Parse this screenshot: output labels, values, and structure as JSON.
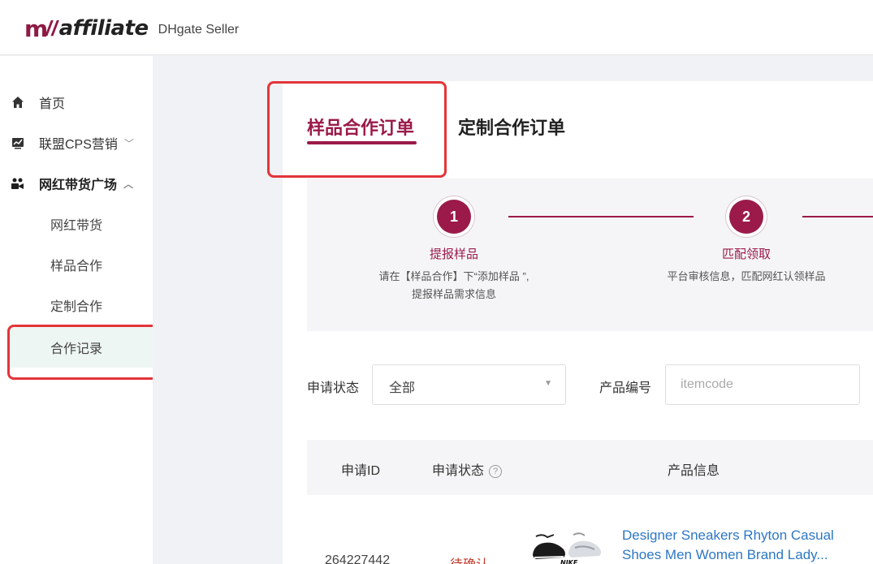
{
  "header": {
    "logo_mark": "m",
    "logo_text": "affiliate",
    "logo_sub": "DHgate Seller"
  },
  "sidebar": {
    "items": [
      {
        "label": "首页",
        "icon": "home-icon"
      },
      {
        "label": "联盟CPS营销",
        "icon": "chart-icon",
        "caret": "﹀"
      },
      {
        "label": "网红带货广场",
        "icon": "influencer-icon",
        "caret": "︿"
      }
    ],
    "subitems": [
      {
        "label": "网红带货"
      },
      {
        "label": "样品合作"
      },
      {
        "label": "定制合作"
      },
      {
        "label": "合作记录",
        "active": true
      }
    ]
  },
  "tabs": [
    {
      "label": "样品合作订单",
      "active": true
    },
    {
      "label": "定制合作订单",
      "active": false
    }
  ],
  "steps": [
    {
      "number": "1",
      "title": "提报样品",
      "desc_line1": "请在【样品合作】下“添加样品 ”,",
      "desc_line2": "提报样品需求信息"
    },
    {
      "number": "2",
      "title": "匹配领取",
      "desc_line1": "平台审核信息，匹配网红认领样品",
      "desc_line2": ""
    }
  ],
  "filters": {
    "status_label": "申请状态",
    "status_value": "全部",
    "code_label": "产品编号",
    "code_placeholder": "itemcode"
  },
  "table": {
    "headers": {
      "id": "申请ID",
      "status": "申请状态",
      "product": "产品信息"
    },
    "help_symbol": "?",
    "rows": [
      {
        "id": "264227442",
        "status": "待确认",
        "product": "Designer Sneakers Rhyton Casual Shoes Men Women Brand Lady..."
      }
    ]
  },
  "colors": {
    "brand": "#9b1a4a",
    "highlight": "#e2353a",
    "link": "#2d77c4"
  }
}
